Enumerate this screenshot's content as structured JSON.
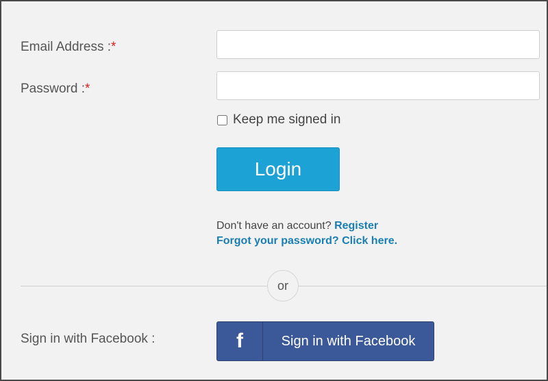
{
  "form": {
    "email": {
      "label": "Email Address :",
      "required_mark": "*",
      "value": "",
      "placeholder": ""
    },
    "password": {
      "label": "Password :",
      "required_mark": "*",
      "value": "",
      "placeholder": ""
    },
    "keep_signed_in": {
      "label": "Keep me signed in",
      "checked": false
    },
    "login_button": "Login",
    "no_account_text": "Don't have an account?",
    "register_link": "Register",
    "forgot_link": "Forgot your password? Click here."
  },
  "divider": {
    "or_text": "or"
  },
  "facebook": {
    "label": "Sign in with Facebook :",
    "icon": "facebook-f-icon",
    "icon_glyph": "f",
    "button_text": "Sign in with Facebook",
    "brand_color": "#3b5998"
  },
  "colors": {
    "accent": "#1ca2d4",
    "link": "#1a7fb0",
    "required": "#e02020",
    "background": "#f2f2f2"
  }
}
